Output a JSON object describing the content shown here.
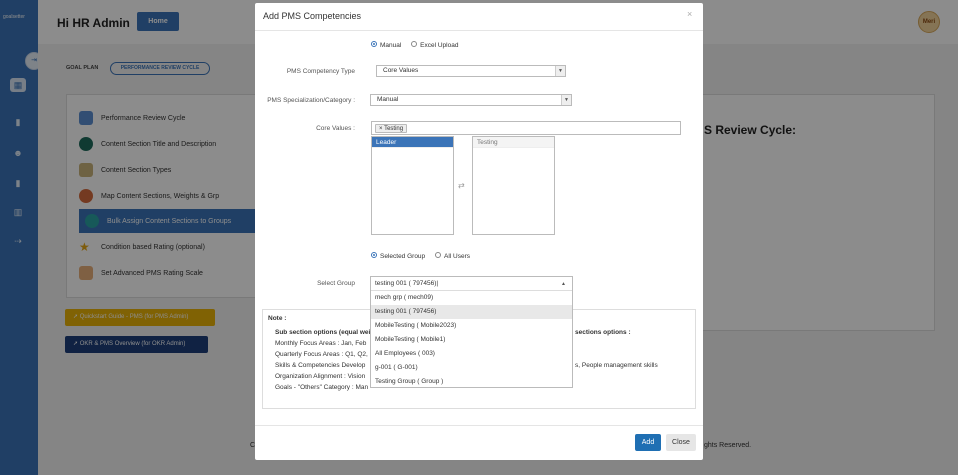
{
  "app": {
    "logo_text": "goalsetter",
    "greeting": "Hi HR Admin",
    "home_label": "Home",
    "avatar_initials": "Meri"
  },
  "nav": {
    "goal_plan": "GOAL PLAN",
    "cycle_pill": "PERFORMANCE REVIEW CYCLE"
  },
  "sidebar_items": [
    {
      "label": "Performance Review Cycle",
      "icon": "calendar-icon",
      "color": "#5b8fd1"
    },
    {
      "label": "Content Section Title and Description",
      "icon": "dots-icon",
      "color": "#1e6b5c"
    },
    {
      "label": "Content Section Types",
      "icon": "list-icon",
      "color": "#c8b27a"
    },
    {
      "label": "Map Content Sections, Weights & Grp",
      "icon": "person-icon",
      "color": "#d46a3c"
    },
    {
      "label": "Bulk Assign Content Sections to Groups",
      "icon": "group-icon",
      "color": "#2aa3a3"
    },
    {
      "label": "Condition based Rating (optional)",
      "icon": "star-icon",
      "color": "#e6a817"
    },
    {
      "label": "Set Advanced PMS Rating Scale",
      "icon": "pencil-icon",
      "color": "#e8b07a"
    }
  ],
  "quickstart_label": "Quickstart Guide - PMS (for PMS Admin)",
  "okr_label": "OKR & PMS Overview (for OKR Admin)",
  "right_title": "S Review Cycle:",
  "footer_left": "C",
  "footer_right": "ghts Reserved.",
  "modal": {
    "title": "Add PMS Competencies",
    "close": "×",
    "mode_options": [
      "Manual",
      "Excel Upload"
    ],
    "mode_selected": "Manual",
    "competency_type_label": "PMS Competency Type",
    "competency_type_value": "Core Values",
    "specialization_label": "PMS Specialization/Category :",
    "specialization_value": "Manual",
    "core_values_label": "Core Values :",
    "core_values_tag": "Testing",
    "left_list": [
      "Leader"
    ],
    "right_list": [
      "Testing"
    ],
    "group_options": [
      "Selected Group",
      "All Users"
    ],
    "group_selected": "Selected Group",
    "select_group_label": "Select Group",
    "select_group_value": "testing 001 ( 797456)|",
    "dropdown_items": [
      "mech grp ( mech09)",
      "testing 001 ( 797456)",
      "MobileTesting ( Mobile2023)",
      "MobileTesting ( Mobile1)",
      "All Employees ( 003)",
      "g-001 ( G-001)",
      "Testing Group ( Group )"
    ],
    "note": {
      "heading": "Note :",
      "line1_left": "Sub section options (equal wei",
      "line1_right": "sections options :",
      "line2": "Monthly Focus Areas : Jan, Feb",
      "line3": "Quarterly Focus Areas : Q1, Q2,",
      "line4_left": "Skills & Competencies Develop",
      "line4_right": "s, People management skills",
      "line5": "Organization Alignment : Vision",
      "line6": "Goals - \"Others\" Category : Man"
    },
    "add_label": "Add",
    "close_label": "Close"
  }
}
